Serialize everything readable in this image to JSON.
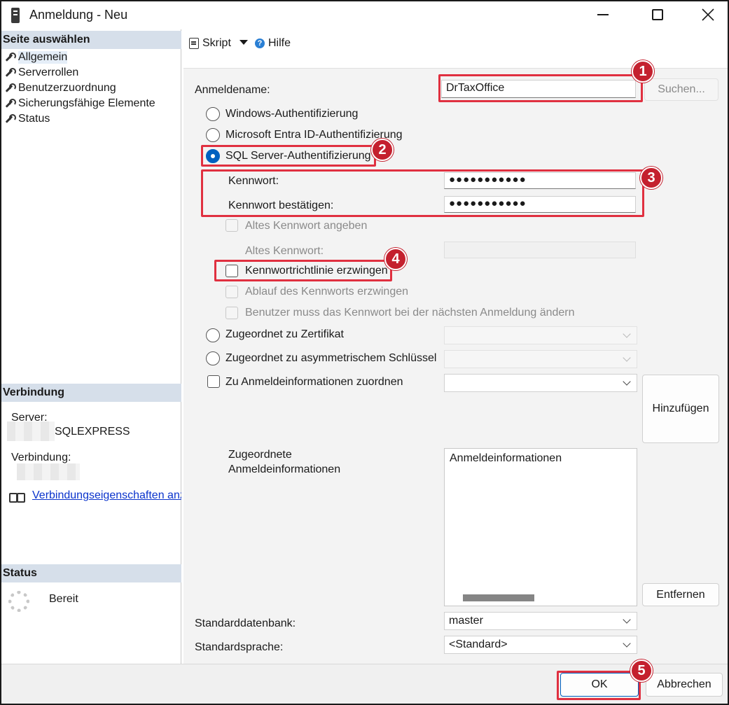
{
  "window": {
    "title": "Anmeldung - Neu"
  },
  "left_pane": {
    "select_page_header": "Seite auswählen",
    "pages": [
      {
        "label": "Allgemein",
        "active": true
      },
      {
        "label": "Serverrollen"
      },
      {
        "label": "Benutzerzuordnung"
      },
      {
        "label": "Sicherungsfähige Elemente"
      },
      {
        "label": "Status"
      }
    ],
    "connection_header": "Verbindung",
    "server_label": "Server:",
    "server_value": "SQLEXPRESS",
    "connection_label": "Verbindung:",
    "connection_props_link": "Verbindungseigenschaften anzeigen",
    "status_header": "Status",
    "status_value": "Bereit"
  },
  "toolbar": {
    "script_label": "Skript",
    "help_label": "Hilfe"
  },
  "form": {
    "login_name_label": "Anmeldename:",
    "login_name_value": "DrTaxOffice",
    "search_button": "Suchen...",
    "auth_windows": "Windows-Authentifizierung",
    "auth_entra": "Microsoft Entra ID-Authentifizierung",
    "auth_sql": "SQL Server-Authentifizierung",
    "password_label": "Kennwort:",
    "password_value": "●●●●●●●●●●●",
    "confirm_password_label": "Kennwort bestätigen:",
    "confirm_password_value": "●●●●●●●●●●●",
    "old_password_checkbox": "Altes Kennwort angeben",
    "old_password_label": "Altes Kennwort:",
    "enforce_policy": "Kennwortrichtlinie erzwingen",
    "enforce_expiration": "Ablauf des Kennworts erzwingen",
    "must_change": "Benutzer muss das Kennwort bei der nächsten Anmeldung ändern",
    "mapped_certificate": "Zugeordnet zu Zertifikat",
    "mapped_asym_key": "Zugeordnet zu asymmetrischem Schlüssel",
    "map_credentials": "Zu Anmeldeinformationen zuordnen",
    "add_button": "Hinzufügen",
    "mapped_credentials_label_line1": "Zugeordnete",
    "mapped_credentials_label_line2": "Anmeldeinformationen",
    "credentials_column": "Anmeldeinformationen",
    "remove_button": "Entfernen",
    "default_db_label": "Standarddatenbank:",
    "default_db_value": "master",
    "default_lang_label": "Standardsprache:",
    "default_lang_value": "<Standard>"
  },
  "footer": {
    "ok_button": "OK",
    "cancel_button": "Abbrechen"
  },
  "annotations": [
    "1",
    "2",
    "3",
    "4",
    "5"
  ],
  "colors": {
    "highlight": "#e03040",
    "badge": "#c4202e",
    "section_header": "#d6dfea",
    "radio_selected": "#0060c0",
    "link": "#0a33cc"
  }
}
